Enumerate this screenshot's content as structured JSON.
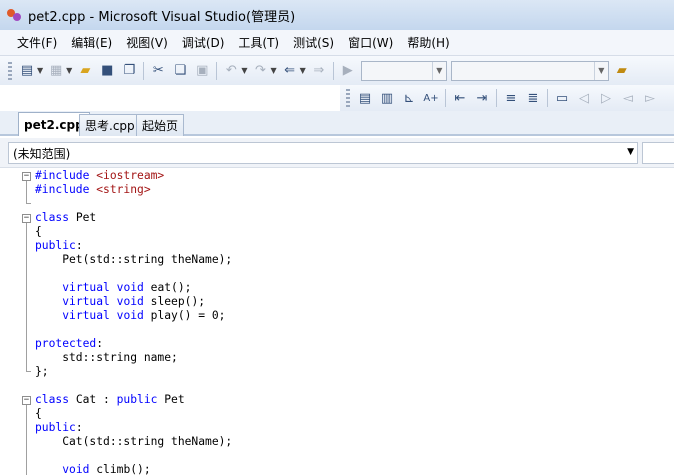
{
  "window": {
    "title": "pet2.cpp - Microsoft Visual Studio(管理员)"
  },
  "menu": [
    {
      "label": "文件(F)"
    },
    {
      "label": "编辑(E)"
    },
    {
      "label": "视图(V)"
    },
    {
      "label": "调试(D)"
    },
    {
      "label": "工具(T)"
    },
    {
      "label": "测试(S)"
    },
    {
      "label": "窗口(W)"
    },
    {
      "label": "帮助(H)"
    }
  ],
  "tabs": [
    {
      "label": "pet2.cpp",
      "active": true
    },
    {
      "label": "思考.cpp",
      "active": false
    },
    {
      "label": "起始页",
      "active": false
    }
  ],
  "scope": {
    "value": "(未知范围)"
  },
  "editor": {
    "lines": [
      {
        "segments": [
          {
            "t": "#include ",
            "c": "kw"
          },
          {
            "t": "<iostream>",
            "c": "str"
          }
        ]
      },
      {
        "segments": [
          {
            "t": "#include ",
            "c": "kw"
          },
          {
            "t": "<string>",
            "c": "str"
          }
        ]
      },
      {
        "segments": []
      },
      {
        "segments": [
          {
            "t": "class ",
            "c": "kw"
          },
          {
            "t": "Pet",
            "c": ""
          }
        ]
      },
      {
        "segments": [
          {
            "t": "{",
            "c": ""
          }
        ]
      },
      {
        "segments": [
          {
            "t": "public",
            "c": "kw"
          },
          {
            "t": ":",
            "c": ""
          }
        ]
      },
      {
        "segments": [
          {
            "t": "    Pet(std::string theName);",
            "c": ""
          }
        ]
      },
      {
        "segments": []
      },
      {
        "segments": [
          {
            "t": "    ",
            "c": ""
          },
          {
            "t": "virtual ",
            "c": "kw"
          },
          {
            "t": "void ",
            "c": "kw"
          },
          {
            "t": "eat();",
            "c": ""
          }
        ]
      },
      {
        "segments": [
          {
            "t": "    ",
            "c": ""
          },
          {
            "t": "virtual ",
            "c": "kw"
          },
          {
            "t": "void ",
            "c": "kw"
          },
          {
            "t": "sleep();",
            "c": ""
          }
        ]
      },
      {
        "segments": [
          {
            "t": "    ",
            "c": ""
          },
          {
            "t": "virtual ",
            "c": "kw"
          },
          {
            "t": "void ",
            "c": "kw"
          },
          {
            "t": "play() = 0;",
            "c": ""
          }
        ]
      },
      {
        "segments": []
      },
      {
        "segments": [
          {
            "t": "protected",
            "c": "kw"
          },
          {
            "t": ":",
            "c": ""
          }
        ]
      },
      {
        "segments": [
          {
            "t": "    std::string name;",
            "c": ""
          }
        ]
      },
      {
        "segments": [
          {
            "t": "};",
            "c": ""
          }
        ]
      },
      {
        "segments": []
      },
      {
        "segments": [
          {
            "t": "class ",
            "c": "kw"
          },
          {
            "t": "Cat : ",
            "c": ""
          },
          {
            "t": "public ",
            "c": "kw"
          },
          {
            "t": "Pet",
            "c": ""
          }
        ]
      },
      {
        "segments": [
          {
            "t": "{",
            "c": ""
          }
        ]
      },
      {
        "segments": [
          {
            "t": "public",
            "c": "kw"
          },
          {
            "t": ":",
            "c": ""
          }
        ]
      },
      {
        "segments": [
          {
            "t": "    Cat(std::string theName);",
            "c": ""
          }
        ]
      },
      {
        "segments": []
      },
      {
        "segments": [
          {
            "t": "    ",
            "c": ""
          },
          {
            "t": "void ",
            "c": "kw"
          },
          {
            "t": "climb();",
            "c": ""
          }
        ]
      }
    ],
    "fold_marker": "−"
  },
  "colors": {
    "keyword": "#0000ff",
    "string": "#a31515",
    "title_gradient": "#c4d7ee"
  }
}
